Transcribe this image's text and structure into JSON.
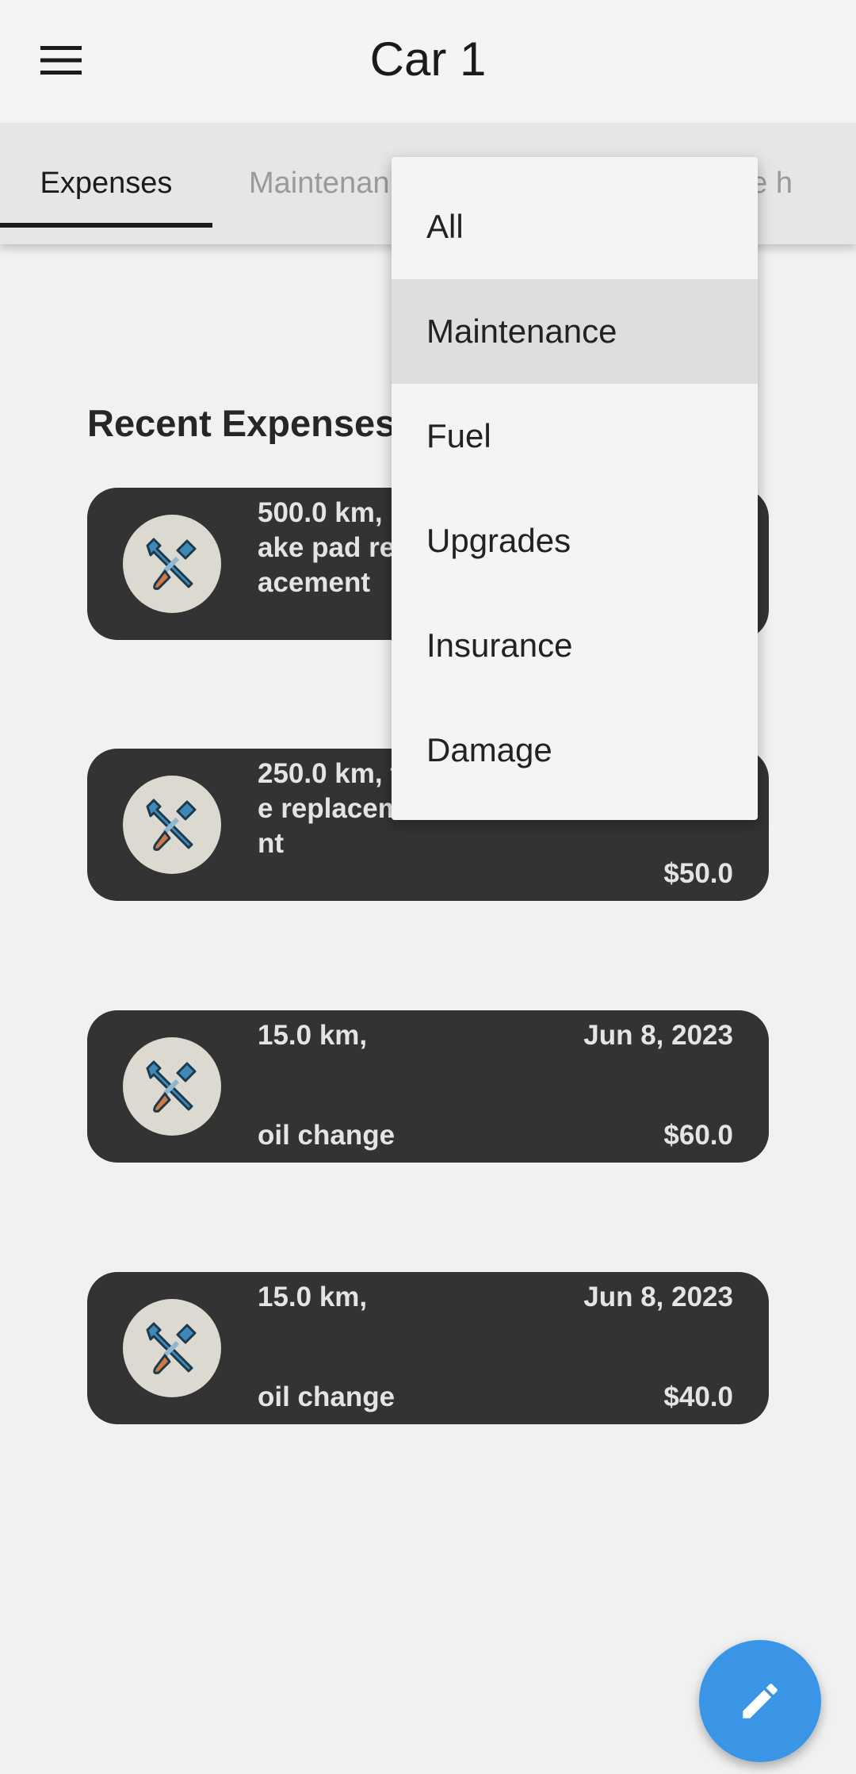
{
  "appbar": {
    "title": "Car 1",
    "menu_icon": "hamburger-menu-icon"
  },
  "tabs": [
    {
      "label": "Expenses",
      "selected": true
    },
    {
      "label": "Maintenan",
      "selected": false
    },
    {
      "label": "ge h",
      "selected": false
    }
  ],
  "section_title": "Recent Expenses",
  "expenses": [
    {
      "description": "500.0 km, brake pad replacement",
      "date": "",
      "amount": "",
      "icon": "tools-wrench-screwdriver-icon"
    },
    {
      "description": "250.0 km, tire replacement",
      "date": "",
      "amount": "$50.0",
      "icon": "tools-wrench-screwdriver-icon"
    },
    {
      "km": "15.0 km,",
      "type": "oil change",
      "date": "Jun 8, 2023",
      "amount": "$60.0",
      "icon": "tools-wrench-screwdriver-icon"
    },
    {
      "km": "15.0 km,",
      "type": "oil change",
      "date": "Jun 8, 2023",
      "amount": "$40.0",
      "icon": "tools-wrench-screwdriver-icon"
    }
  ],
  "dropdown": {
    "items": [
      "All",
      "Maintenance",
      "Fuel",
      "Upgrades",
      "Insurance",
      "Damage"
    ],
    "highlighted": "Maintenance"
  },
  "fab": {
    "icon": "pencil-edit-icon"
  },
  "colors": {
    "fab": "#3a95e6",
    "card": "#333333",
    "icon_bg": "#dcdad0"
  }
}
